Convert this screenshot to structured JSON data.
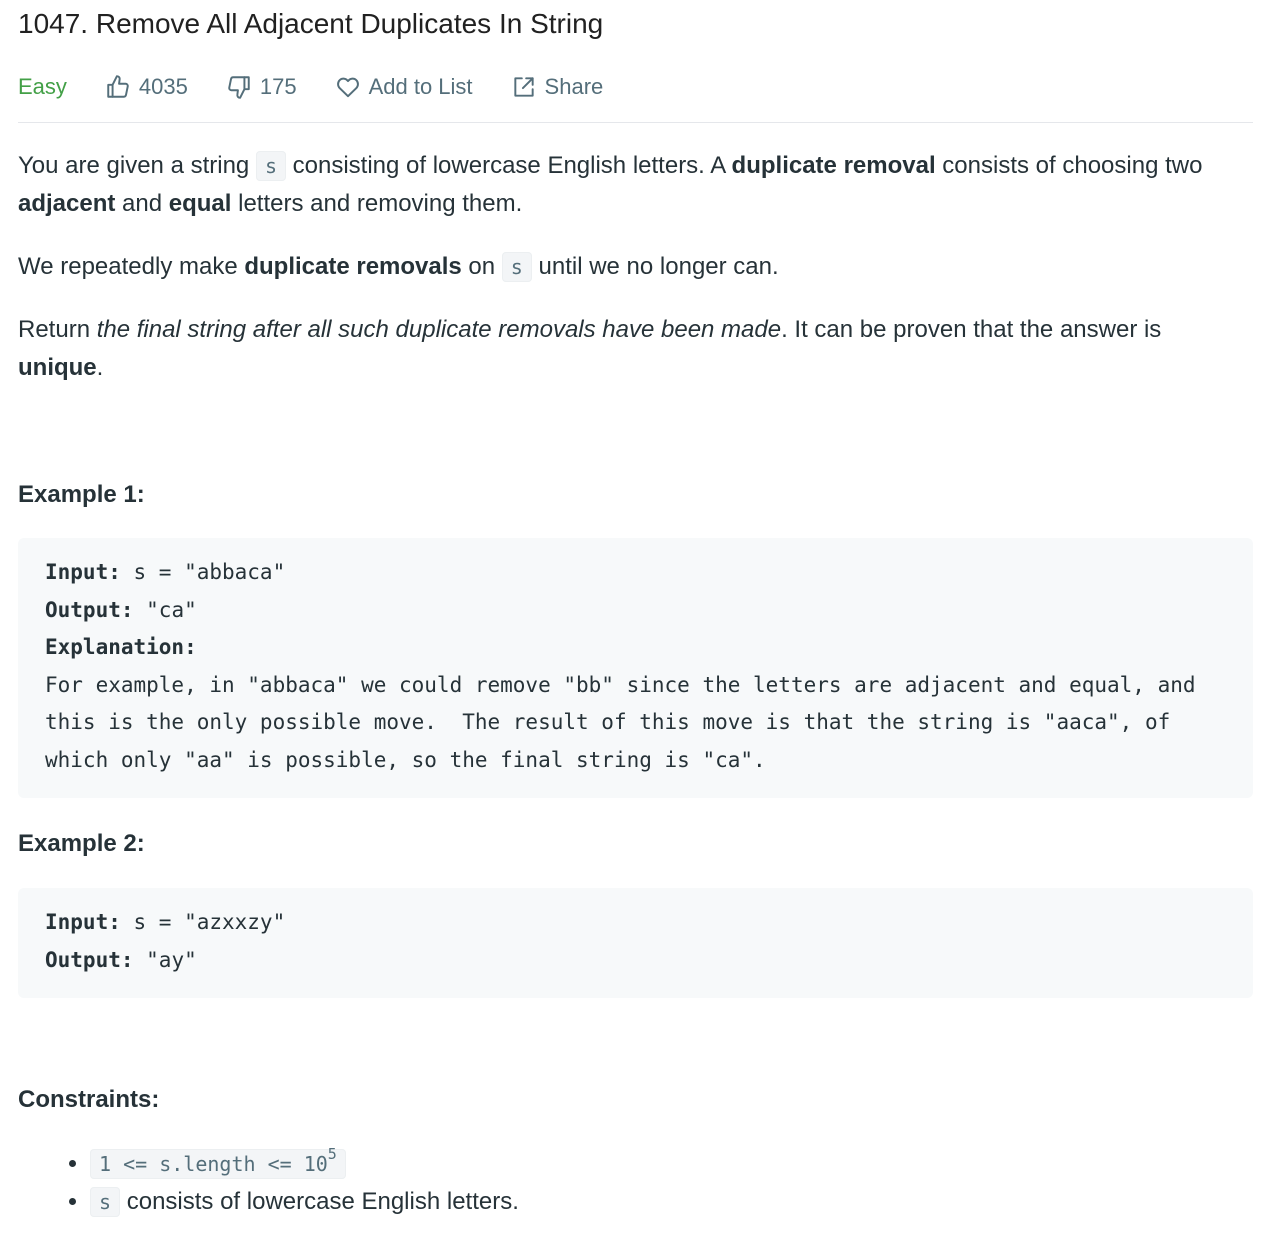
{
  "problem": {
    "title": "1047. Remove All Adjacent Duplicates In String",
    "difficulty": "Easy",
    "likes": "4035",
    "dislikes": "175",
    "add_to_list": "Add to List",
    "share": "Share"
  },
  "description": {
    "p1_a": "You are given a string ",
    "p1_code": "s",
    "p1_b": " consisting of lowercase English letters. A ",
    "p1_bold1": "duplicate removal",
    "p1_c": " consists of choosing two ",
    "p1_bold2": "adjacent",
    "p1_d": " and ",
    "p1_bold3": "equal",
    "p1_e": " letters and removing them.",
    "p2_a": "We repeatedly make ",
    "p2_bold": "duplicate removals",
    "p2_b": " on ",
    "p2_code": "s",
    "p2_c": " until we no longer can.",
    "p3_a": "Return ",
    "p3_italic": "the final string after all such duplicate removals have been made",
    "p3_b": ". It can be proven that the answer is ",
    "p3_bold": "unique",
    "p3_c": "."
  },
  "examples": [
    {
      "title": "Example 1:",
      "input_label": "Input:",
      "input_value": " s = \"abbaca\"",
      "output_label": "Output:",
      "output_value": " \"ca\"",
      "explanation_label": "Explanation:",
      "explanation_text": "For example, in \"abbaca\" we could remove \"bb\" since the letters are adjacent and equal, and this is the only possible move.  The result of this move is that the string is \"aaca\", of which only \"aa\" is possible, so the final string is \"ca\"."
    },
    {
      "title": "Example 2:",
      "input_label": "Input:",
      "input_value": " s = \"azxxzy\"",
      "output_label": "Output:",
      "output_value": " \"ay\""
    }
  ],
  "constraints": {
    "title": "Constraints:",
    "c1_code": "1 <= s.length <= 10",
    "c1_sup": "5",
    "c2_code": "s",
    "c2_text": " consists of lowercase English letters."
  },
  "colors": {
    "difficulty_easy": "#43a047",
    "meta_text": "#546e7a",
    "text": "#263238",
    "code_bg": "#f7f9fa"
  }
}
